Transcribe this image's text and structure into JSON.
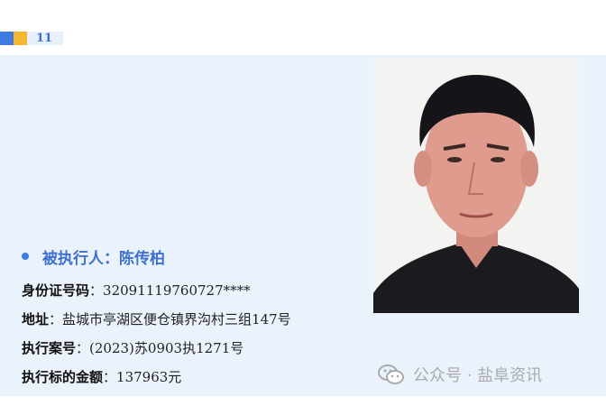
{
  "header": {
    "section_number": "11"
  },
  "person": {
    "name_label": "被执行人",
    "separator": "：",
    "name": "陈传柏",
    "photo_icon": "person-photo"
  },
  "details": [
    {
      "label": "身份证号码",
      "separator": "：",
      "value": "32091119760727****"
    },
    {
      "label": "地址",
      "separator": "：",
      "value": "盐城市亭湖区便仓镇界沟村三组147号"
    },
    {
      "label": "执行案号",
      "separator": "：",
      "value": "(2023)苏0903执1271号"
    },
    {
      "label": "执行标的金额",
      "separator": "：",
      "value": "137963元"
    }
  ],
  "watermark": {
    "icon": "wechat-icon",
    "text": "公众号 · 盐阜资讯"
  },
  "colors": {
    "accent_blue": "#3f7ae0",
    "accent_yellow": "#f5b731",
    "panel_bg": "#eaf2fc",
    "name_color": "#3f6fd1"
  }
}
